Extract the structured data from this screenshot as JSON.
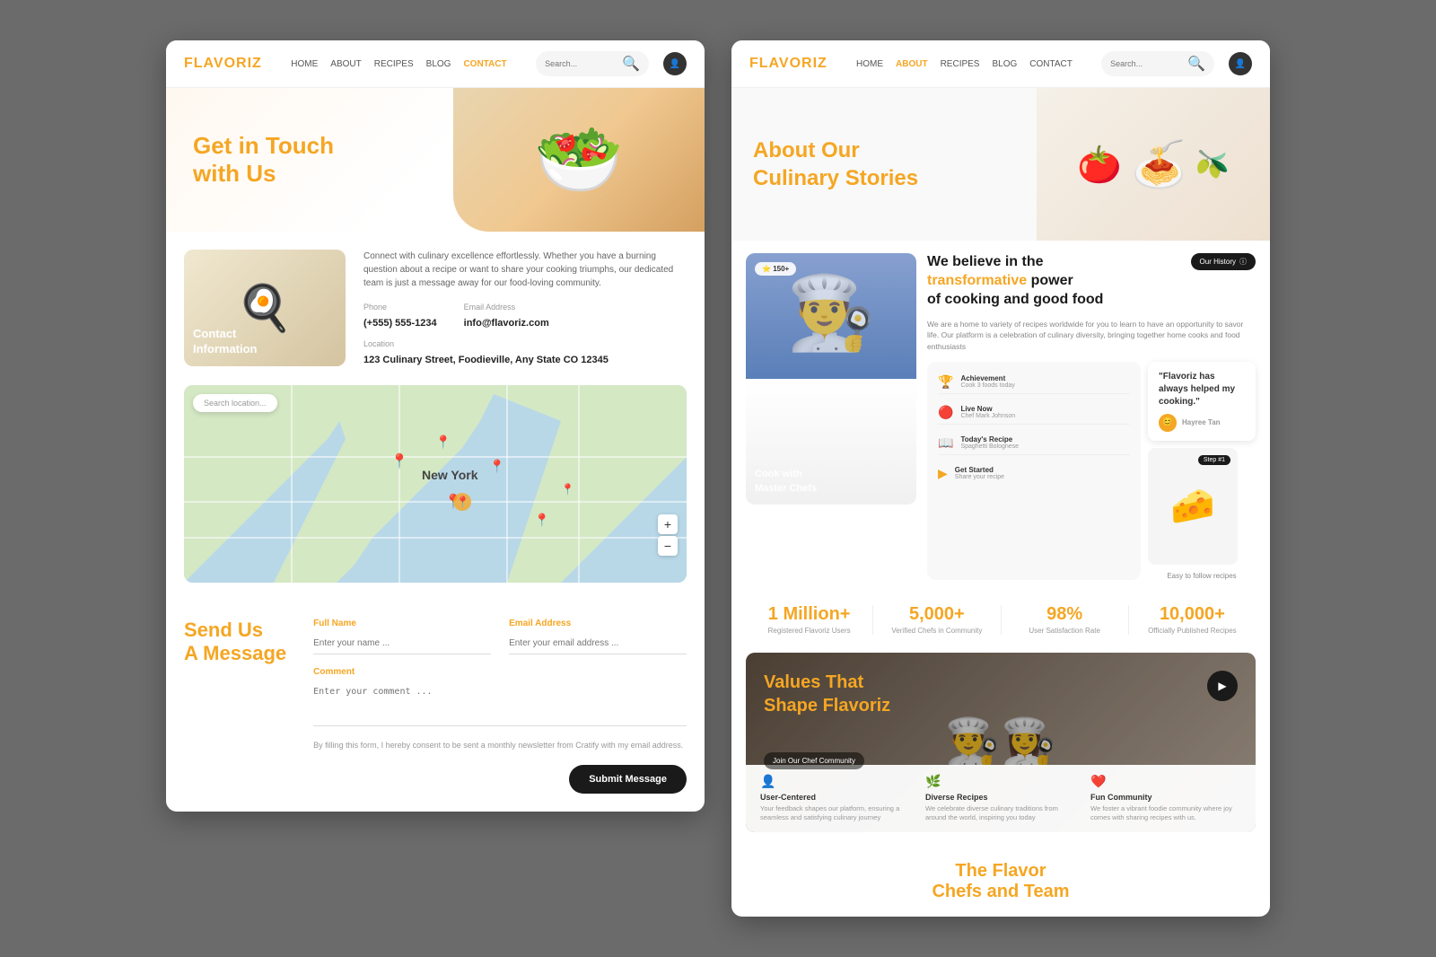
{
  "page1": {
    "logo": {
      "prefix": "FLA",
      "suffix": "VORIZ"
    },
    "nav": {
      "links": [
        "HOME",
        "ABOUT",
        "RECIPES",
        "BLOG",
        "CONTACT"
      ],
      "active": "CONTACT",
      "search_placeholder": "Search..."
    },
    "hero": {
      "line1": "Get in Touch",
      "line2": "with",
      "line2_span": "Us"
    },
    "contact_section": {
      "description": "Connect with culinary excellence effortlessly. Whether you have a burning question about a recipe or want to share your cooking triumphs, our dedicated team is just a message away for our food-loving community.",
      "image_label_line1": "Contact",
      "image_label_line2": "Information",
      "phone_label": "Phone",
      "phone": "(+555) 555-1234",
      "email_label": "Email Address",
      "email": "info@flavoriz.com",
      "location_label": "Location",
      "location": "123 Culinary Street, Foodieville, Any State CO 12345"
    },
    "map": {
      "search_placeholder": "Search location...",
      "zoom_in": "+",
      "zoom_out": "−"
    },
    "form": {
      "title_regular": "Send",
      "title_span": "Us",
      "title_line2": "A Message",
      "full_name_label": "Full Name",
      "full_name_placeholder": "Enter your name ...",
      "email_label": "Email Address",
      "email_placeholder": "Enter your email address ...",
      "comment_label": "Comment",
      "comment_placeholder": "Enter your comment ...",
      "consent_text": "By filling this form, I hereby consent to be sent a monthly newsletter from Cratify with my email address.",
      "submit_label": "Submit Message"
    }
  },
  "page2": {
    "logo": {
      "prefix": "FLA",
      "suffix": "VORIZ"
    },
    "nav": {
      "links": [
        "HOME",
        "ABOUT",
        "RECIPES",
        "BLOG",
        "CONTACT"
      ],
      "active": "ABOUT",
      "search_placeholder": "Search..."
    },
    "about_hero": {
      "line1": "About Our",
      "line2_regular": "",
      "line2_span": "Culinary",
      "line2_suffix": " Stories"
    },
    "belief": {
      "heading_line1": "We believe in the",
      "heading_span": "transformative",
      "heading_suffix": " power",
      "heading_line3": "of cooking and good food",
      "description": "We are a home to variety of recipes worldwide for you to learn to have an opportunity to savor life. Our platform is a celebration of culinary diversity, bringing together home cooks and food enthusiasts",
      "chef_label_line1": "Cook with",
      "chef_label_line2": "Master Chefs",
      "reviews_count": "150+",
      "history_badge": "Our History",
      "cards": [
        {
          "icon": "🏆",
          "title": "Achievement",
          "sub": "Cook 3 foods today"
        },
        {
          "icon": "🔴",
          "title": "Live Now",
          "sub": "Chef Mark Johnson"
        },
        {
          "icon": "📖",
          "title": "Today's Recipe",
          "sub": "Spaghetti Bolognese"
        },
        {
          "icon": "▶",
          "title": "Get Started",
          "sub": "Share your recipe"
        }
      ],
      "testimony": "\"Flavoriz has always helped my cooking.\"",
      "testimony_user": "Hayree Tan",
      "step_label": "Step #1",
      "easy_label": "Easy to follow recipes"
    },
    "stats": [
      {
        "number": "1 Million+",
        "label": "Registered Flavoriz Users"
      },
      {
        "number": "5,000+",
        "label": "Verified Chefs in Community"
      },
      {
        "number": "98%",
        "label": "User Satisfaction Rate"
      },
      {
        "number": "10,000+",
        "label": "Officially Published Recipes"
      }
    ],
    "values": {
      "title_regular": "Values That",
      "title_span": "Shape",
      "title_suffix": " Flavoriz",
      "join_btn": "Join Our Chef Community",
      "cards": [
        {
          "icon": "👤",
          "title": "User-Centered",
          "desc": "Your feedback shapes our platform, ensuring a seamless and satisfying culinary journey"
        },
        {
          "icon": "🌿",
          "title": "Diverse Recipes",
          "desc": "We celebrate diverse culinary traditions from around the world, inspiring you today"
        },
        {
          "icon": "❤",
          "title": "Fun Community",
          "desc": "We foster a vibrant foodie community where joy comes with sharing recipes with us."
        }
      ]
    },
    "team": {
      "title_regular": "The Flavor",
      "title_span": "Chefs",
      "title_suffix": " and Team"
    }
  }
}
